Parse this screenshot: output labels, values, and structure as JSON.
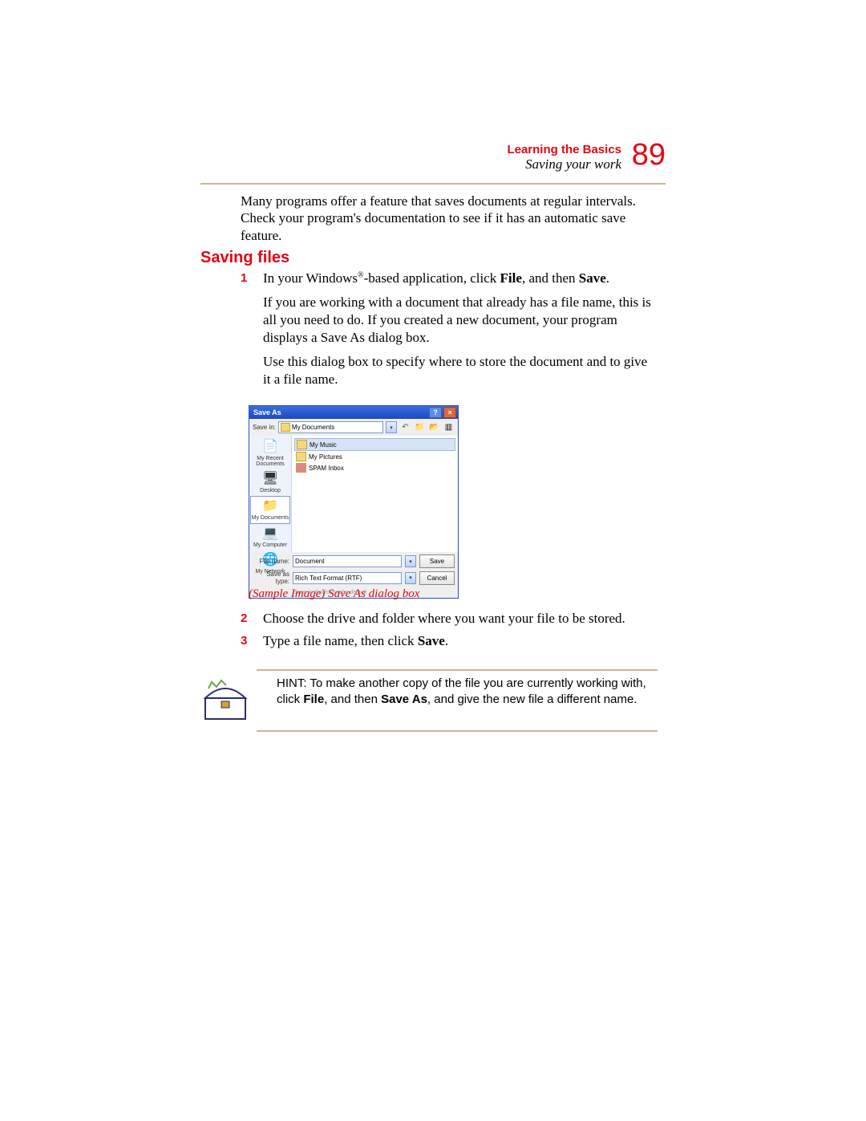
{
  "header": {
    "chapter": "Learning the Basics",
    "section": "Saving your work",
    "page_number": "89"
  },
  "intro": "Many programs offer a feature that saves documents at regular intervals. Check your program's documentation to see if it has an automatic save feature.",
  "section_heading": "Saving files",
  "steps": {
    "s1": {
      "num": "1",
      "line1_pre": "In your Windows",
      "line1_mid": "-based application, click ",
      "file": "File",
      "line1_post": ", and then ",
      "save": "Save",
      "line1_end": ".",
      "p2": "If you are working with a document that already has a file name, this is all you need to do. If you created a new document, your program displays a Save As dialog box.",
      "p3": "Use this dialog box to specify where to store the document and to give it a file name."
    },
    "s2": {
      "num": "2",
      "text": "Choose the drive and folder where you want your file to be stored."
    },
    "s3": {
      "num": "3",
      "pre": "Type a file name, then click ",
      "save": "Save",
      "post": "."
    }
  },
  "dialog": {
    "title": "Save As",
    "savein_label": "Save in:",
    "savein_value": "My Documents",
    "places": {
      "recent": "My Recent Documents",
      "desktop": "Desktop",
      "mydocs": "My Documents",
      "mycomp": "My Computer",
      "mynet": "My Network"
    },
    "files": {
      "music": "My Music",
      "pictures": "My Pictures",
      "spam": "SPAM Inbox"
    },
    "filename_label": "File name:",
    "filename_value": "Document",
    "saveastype_label": "Save as type:",
    "saveastype_value": "Rich Text Format (RTF)",
    "save_btn": "Save",
    "cancel_btn": "Cancel",
    "footer": "Save in this format by default"
  },
  "caption": "Sample Image) Save As dialog box",
  "hint": {
    "pre": "HINT: To make another copy of the file you are currently working with, click ",
    "file": "File",
    "mid": ", and then ",
    "saveas": "Save As",
    "post": ", and give the new file a different name."
  }
}
